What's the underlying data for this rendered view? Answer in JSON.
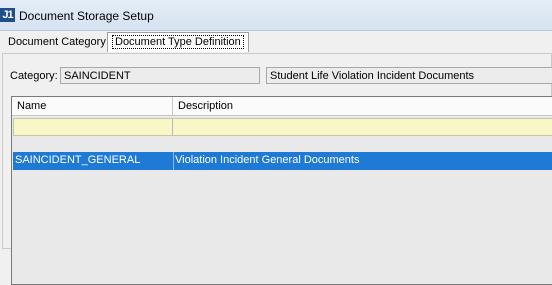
{
  "window": {
    "title": "Document Storage Setup",
    "icon_text": "J1"
  },
  "tabs": [
    "Document Category",
    "Document Type Definition"
  ],
  "category": {
    "label": "Category:",
    "code": "SAINCIDENT",
    "description": "Student Life Violation Incident Documents"
  },
  "grid": {
    "columns": [
      "Name",
      "Description"
    ],
    "rows": [
      {
        "name": "SAINCIDENT_GENERAL",
        "description": "Violation Incident General Documents"
      }
    ]
  },
  "colors": {
    "selection": "#1f7ad6",
    "filter_row": "#f7f7c8"
  }
}
